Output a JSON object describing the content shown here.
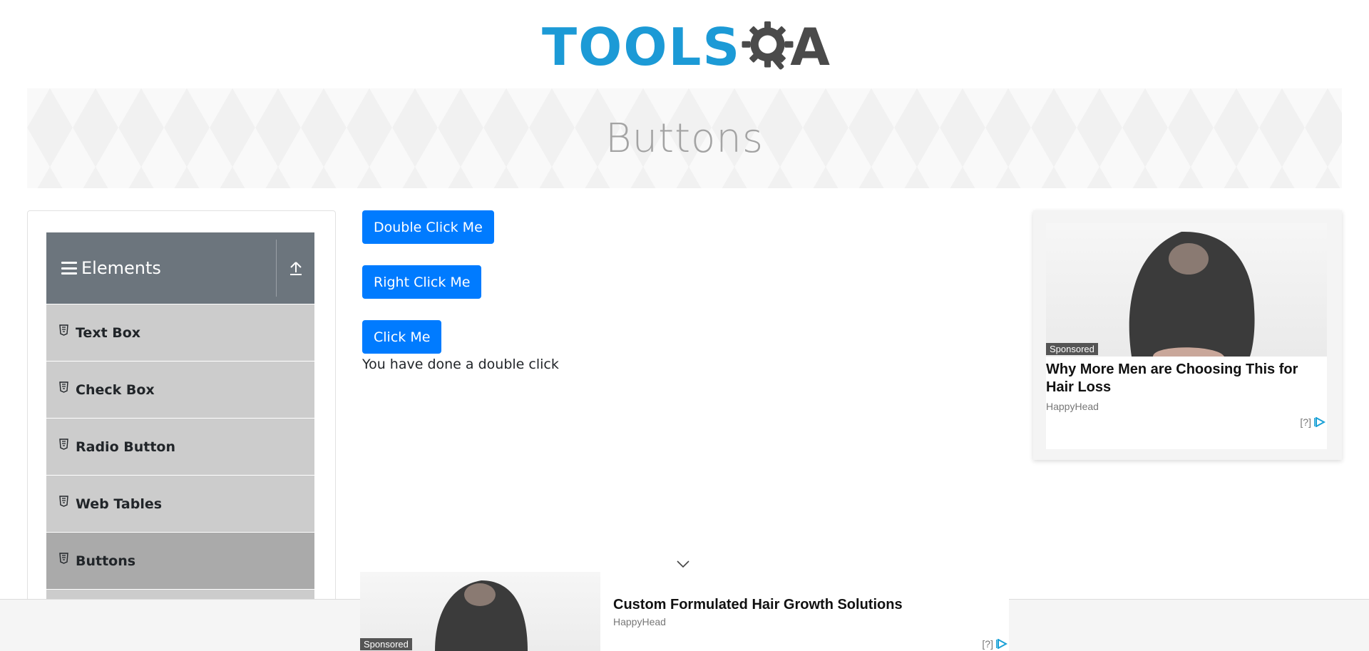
{
  "header": {
    "logo_text": "TOOLS",
    "logo_suffix": "A"
  },
  "banner": {
    "title": "Buttons"
  },
  "sidebar": {
    "group_title": "Elements",
    "items": [
      {
        "label": "Text Box",
        "active": false
      },
      {
        "label": "Check Box",
        "active": false
      },
      {
        "label": "Radio Button",
        "active": false
      },
      {
        "label": "Web Tables",
        "active": false
      },
      {
        "label": "Buttons",
        "active": true
      }
    ]
  },
  "main": {
    "double_click_label": "Double Click Me",
    "right_click_label": "Right Click Me",
    "click_label": "Click Me",
    "result_message": "You have done a double click"
  },
  "right_ad": {
    "sponsored": "Sponsored",
    "headline": "Why More Men are Choosing This for Hair Loss",
    "source": "HappyHead",
    "info": "[?]"
  },
  "bottom_ad": {
    "sponsored": "Sponsored",
    "headline": "Custom Formulated Hair Growth Solutions",
    "source": "HappyHead",
    "info": "[?]"
  },
  "colors": {
    "primary": "#007bff",
    "logo_blue": "#1c9ad6",
    "sidebar_header": "#6c757d",
    "menu_item": "#cccccc",
    "menu_item_active": "#aaaaaa"
  }
}
